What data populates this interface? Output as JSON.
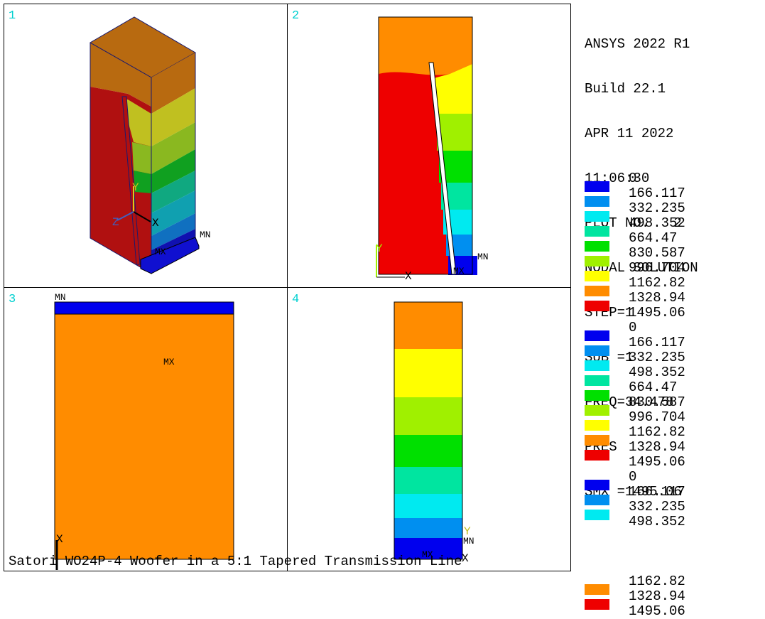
{
  "info": {
    "product": "ANSYS 2022 R1",
    "build": "Build 22.1",
    "date": "APR 11 2022",
    "time": "11:06:30",
    "plot_no": "PLOT NO.   2",
    "solution": "NODAL SOLUTION",
    "step": "STEP=1",
    "sub": "SUB =1",
    "freq": "FREQ=34.478",
    "item": "PRES",
    "smx": "SMX =1495.06"
  },
  "colors": {
    "c0": "#0000ee",
    "c1": "#008ff0",
    "c2": "#00eaf0",
    "c3": "#00e5a0",
    "c4": "#00e000",
    "c5": "#a0f000",
    "c6": "#ffff00",
    "c7": "#ff8c00",
    "c8": "#ee0000",
    "vp_number": "#00e0e0",
    "frame": "#000000"
  },
  "legend_values": [
    "0",
    "166.117",
    "332.235",
    "498.352",
    "664.47",
    "830.587",
    "996.704",
    "1162.82",
    "1328.94",
    "1495.06"
  ],
  "legends": [
    {
      "swatches": [
        "c0",
        "c1",
        "c2",
        "c3",
        "c4",
        "c5",
        "c6",
        "c7",
        "c8"
      ],
      "values": [
        "0",
        "166.117",
        "332.235",
        "498.352",
        "664.47",
        "830.587",
        "996.704",
        "1162.82",
        "1328.94",
        "1495.06"
      ]
    },
    {
      "swatches": [
        "c0",
        "c1",
        "c2",
        "c3",
        "c4",
        "c5",
        "c6",
        "c7",
        "c8"
      ],
      "values": [
        "0",
        "166.117",
        "332.235",
        "498.352",
        "664.47",
        "830.587",
        "996.704",
        "1162.82",
        "1328.94",
        "1495.06"
      ]
    },
    {
      "swatches": [
        "c0",
        "c1",
        "c2",
        "",
        "",
        "",
        "",
        "c7",
        "c8"
      ],
      "values": [
        "0",
        "166.117",
        "332.235",
        "498.352",
        "",
        "",
        "",
        "1162.82",
        "1328.94",
        "1495.06"
      ]
    }
  ],
  "viewports": {
    "vp1": {
      "number": "1",
      "mn": "MN",
      "mx": "MX",
      "axis_x": "X",
      "axis_y": "Y",
      "axis_z": "Z"
    },
    "vp2": {
      "number": "2",
      "mn": "MN",
      "mx": "MX",
      "axis_x": "X",
      "axis_y": "Y"
    },
    "vp3": {
      "number": "3",
      "mn": "MN",
      "mx": "MX",
      "axis_x": "X"
    },
    "vp4": {
      "number": "4",
      "mn": "MN",
      "mx": "MX",
      "axis_x": "X",
      "axis_y": "Y"
    }
  },
  "title": "Satori WO24P-4 Woofer in a 5:1 Tapered Transmission Line"
}
